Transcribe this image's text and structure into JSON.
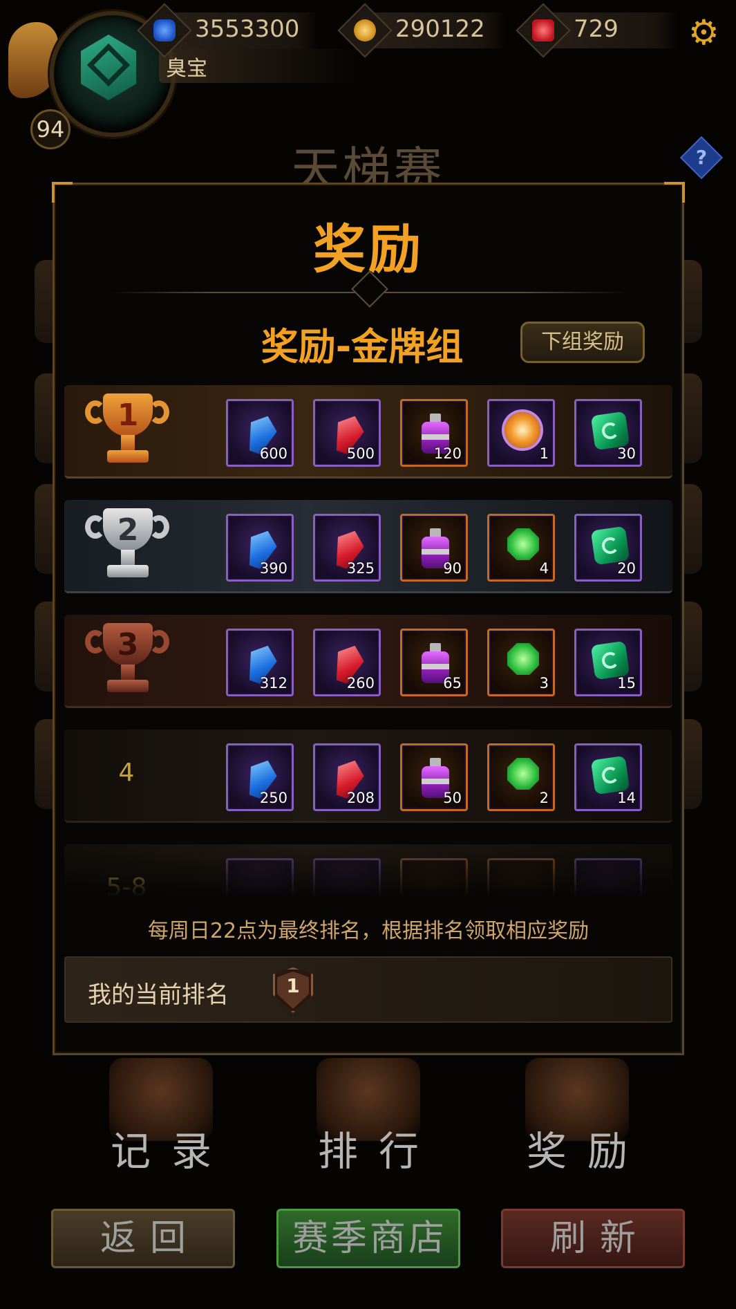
{
  "header": {
    "level": "94",
    "player_name": "臭宝",
    "resources": [
      {
        "icon": "blue-crystal-icon",
        "value": "3553300"
      },
      {
        "icon": "gold-coin-icon",
        "value": "290122"
      },
      {
        "icon": "red-gem-icon",
        "value": "729"
      }
    ],
    "settings_icon": "gear-icon"
  },
  "page": {
    "title": "天梯赛",
    "help_label": "?"
  },
  "modal": {
    "title": "奖励",
    "group_title": "奖励-金牌组",
    "next_group_label": "下组奖励",
    "rows": [
      {
        "rank": "1",
        "trophy": "gold",
        "items": [
          {
            "icon": "blue-crystal-icon",
            "count": "600"
          },
          {
            "icon": "red-crystal-icon",
            "count": "500"
          },
          {
            "icon": "purple-potion-icon",
            "count": "120"
          },
          {
            "icon": "orange-star-gem-icon",
            "count": "1"
          },
          {
            "icon": "green-rune-icon",
            "count": "30"
          }
        ]
      },
      {
        "rank": "2",
        "trophy": "silver",
        "items": [
          {
            "icon": "blue-crystal-icon",
            "count": "390"
          },
          {
            "icon": "red-crystal-icon",
            "count": "325"
          },
          {
            "icon": "purple-potion-icon",
            "count": "90"
          },
          {
            "icon": "green-gem-icon",
            "count": "4"
          },
          {
            "icon": "green-rune-icon",
            "count": "20"
          }
        ]
      },
      {
        "rank": "3",
        "trophy": "bronze",
        "items": [
          {
            "icon": "blue-crystal-icon",
            "count": "312"
          },
          {
            "icon": "red-crystal-icon",
            "count": "260"
          },
          {
            "icon": "purple-potion-icon",
            "count": "65"
          },
          {
            "icon": "green-gem-icon",
            "count": "3"
          },
          {
            "icon": "green-rune-icon",
            "count": "15"
          }
        ]
      },
      {
        "rank": "4",
        "items": [
          {
            "icon": "blue-crystal-icon",
            "count": "250"
          },
          {
            "icon": "red-crystal-icon",
            "count": "208"
          },
          {
            "icon": "purple-potion-icon",
            "count": "50"
          },
          {
            "icon": "green-gem-icon",
            "count": "2"
          },
          {
            "icon": "green-rune-icon",
            "count": "14"
          }
        ]
      },
      {
        "rank": "5-8"
      }
    ],
    "note": "每周日22点为最终排名，根据排名领取相应奖励",
    "my_rank_label": "我的当前排名",
    "my_rank_value": "1"
  },
  "nav": {
    "record": "记录",
    "ranking": "排行",
    "reward": "奖励"
  },
  "buttons": {
    "back": "返回",
    "season_shop": "赛季商店",
    "refresh": "刷新"
  },
  "colors": {
    "accent_orange": "#f2a122",
    "gold_text": "#c9a13c"
  }
}
